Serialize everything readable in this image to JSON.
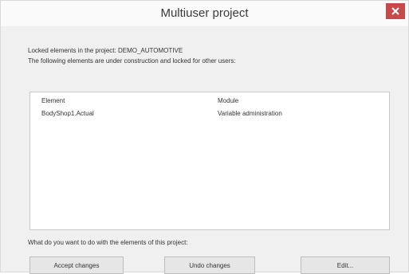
{
  "window": {
    "title": "Multiuser project",
    "close_icon": "close-icon",
    "accent_color": "#c74a4a"
  },
  "info": {
    "line1": "Locked elements in the project: DEMO_AUTOMOTIVE",
    "line2": "The following elements are under construction and locked for other users:"
  },
  "table": {
    "columns": [
      "Element",
      "Module"
    ],
    "rows": [
      {
        "element": "BodyShop1.Actual",
        "module": "Variable administration"
      }
    ]
  },
  "question": "What do you want to do with the elements of this project:",
  "buttons": {
    "accept": "Accept changes",
    "undo": "Undo changes",
    "edit": "Edit..."
  }
}
